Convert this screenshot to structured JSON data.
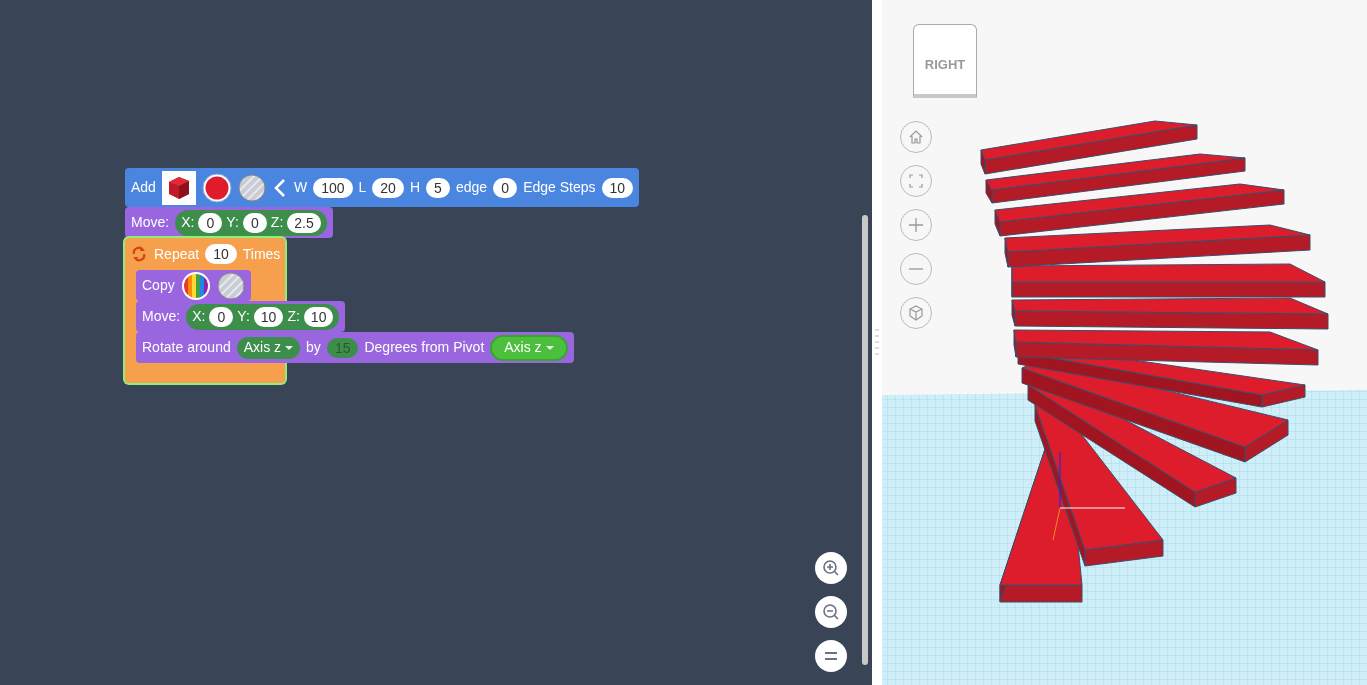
{
  "blocks": [
    {
      "kind": "add",
      "fields": [
        {
          "kind": "label",
          "text": "Add"
        },
        {
          "kind": "shape-thumb"
        },
        {
          "kind": "color-swatch"
        },
        {
          "kind": "material-swatch"
        },
        {
          "kind": "collapse-arrow"
        },
        {
          "kind": "label",
          "text": "W"
        },
        {
          "kind": "number",
          "text": "100"
        },
        {
          "kind": "label",
          "text": "L"
        },
        {
          "kind": "number",
          "text": "20"
        },
        {
          "kind": "label",
          "text": "H"
        },
        {
          "kind": "number",
          "text": "5"
        },
        {
          "kind": "label",
          "text": "edge"
        },
        {
          "kind": "number",
          "text": "0"
        },
        {
          "kind": "label",
          "text": "Edge Steps"
        },
        {
          "kind": "number",
          "text": "10"
        }
      ]
    },
    {
      "kind": "move",
      "fields": [
        {
          "kind": "label",
          "text": "Move:"
        },
        {
          "kind": "xyz",
          "items": [
            {
              "label": "X:",
              "value": "0"
            },
            {
              "label": "Y:",
              "value": "0"
            },
            {
              "label": "Z:",
              "value": "2.5"
            }
          ]
        }
      ]
    },
    {
      "kind": "repeat",
      "selected": true,
      "fields": [
        {
          "kind": "loop-icon"
        },
        {
          "kind": "label",
          "text": "Repeat"
        },
        {
          "kind": "number",
          "text": "10"
        },
        {
          "kind": "label",
          "text": "Times"
        }
      ],
      "children": [
        {
          "kind": "move",
          "fields": [
            {
              "kind": "label",
              "text": "Copy"
            },
            {
              "kind": "rainbow-swatch"
            },
            {
              "kind": "material-swatch"
            }
          ]
        },
        {
          "kind": "move",
          "fields": [
            {
              "kind": "label",
              "text": "Move:"
            },
            {
              "kind": "xyz",
              "items": [
                {
                  "label": "X:",
                  "value": "0"
                },
                {
                  "label": "Y:",
                  "value": "10"
                },
                {
                  "label": "Z:",
                  "value": "10"
                }
              ]
            }
          ]
        },
        {
          "kind": "move",
          "fields": [
            {
              "kind": "label",
              "text": "Rotate around"
            },
            {
              "kind": "dropdown",
              "text": "Axis z",
              "highlighted": false
            },
            {
              "kind": "label",
              "text": "by"
            },
            {
              "kind": "shadow-number",
              "text": "15"
            },
            {
              "kind": "label",
              "text": "Degrees from Pivot"
            },
            {
              "kind": "dropdown",
              "text": "Axis z",
              "highlighted": true
            }
          ]
        }
      ]
    }
  ],
  "view_cube": {
    "label": "RIGHT"
  }
}
